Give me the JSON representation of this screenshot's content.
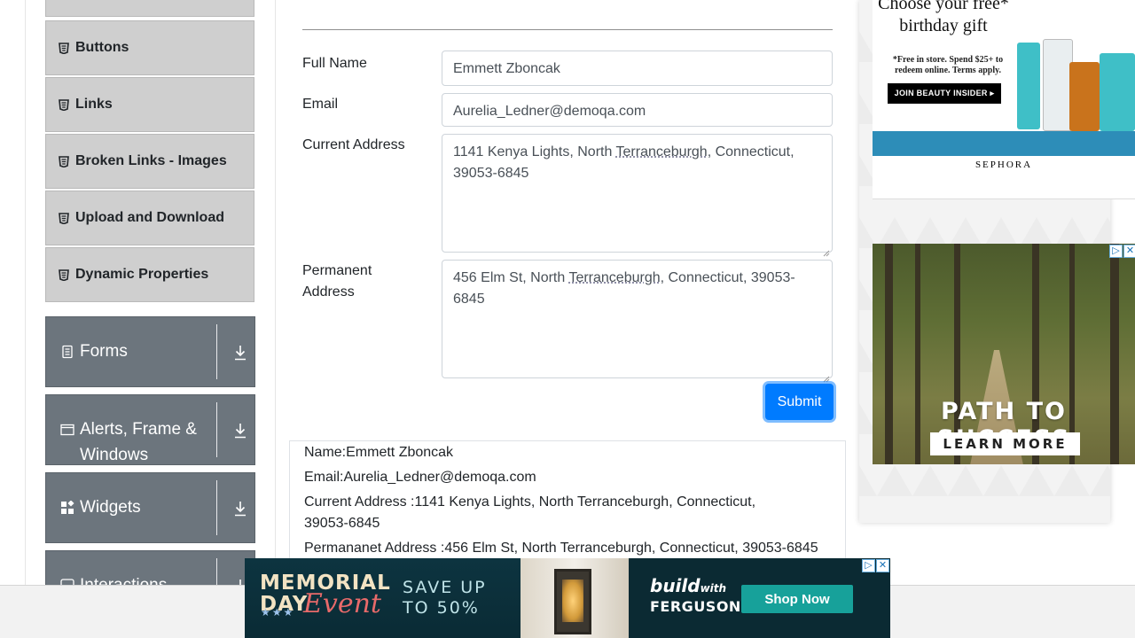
{
  "sidebar": {
    "elements_items": [
      {
        "label": "Buttons"
      },
      {
        "label": "Links"
      },
      {
        "label": "Broken Links - Images"
      },
      {
        "label": "Upload and Download"
      },
      {
        "label": "Dynamic Properties"
      }
    ],
    "groups": [
      {
        "label": "Forms",
        "icon": "form-icon"
      },
      {
        "label": "Alerts, Frame & Windows",
        "icon": "window-icon"
      },
      {
        "label": "Widgets",
        "icon": "widgets-icon"
      },
      {
        "label": "Interactions",
        "icon": "interactions-icon"
      }
    ]
  },
  "form": {
    "full_name_label": "Full Name",
    "full_name_value": "Emmett Zboncak",
    "email_label": "Email",
    "email_value": "Aurelia_Ledner@demoqa.com",
    "current_address_label": "Current Address",
    "current_address_pre": "1141 Kenya Lights, North ",
    "current_address_flagged": "Terranceburgh",
    "current_address_post": ", Connecticut, 39053-6845",
    "permanent_address_label": "Permanent Address",
    "permanent_address_pre": "456 Elm St, North ",
    "permanent_address_flagged": "Terranceburgh",
    "permanent_address_post": ", Connecticut, 39053-6845",
    "submit_label": "Submit"
  },
  "output": {
    "name_line": "Name:Emmett Zboncak",
    "email_line": "Email:Aurelia_Ledner@demoqa.com",
    "current_line": "Current Address :1141 Kenya Lights, North Terranceburgh, Connecticut, 39053-6845",
    "permanent_line": "Permananet Address :456 Elm St, North Terranceburgh, Connecticut, 39053-6845"
  },
  "ads": {
    "sephora": {
      "title": "Choose your free* birthday gift",
      "fine_print": "*Free in store. Spend $25+ to redeem online. Terms apply.",
      "button": "JOIN BEAUTY INSIDER ▸",
      "brand": "SEPHORA"
    },
    "forest": {
      "headline": "PATH TO SUCCESS",
      "cta": "LEARN MORE",
      "adchoices": "▷",
      "close": "✕"
    },
    "banner": {
      "line1": "MEMORIAL",
      "line2": "DAY",
      "event": "Event",
      "save_line1": "SAVE UP",
      "save_line2": "TO 50%",
      "brand1": "build",
      "brand1_suffix": "with",
      "brand2": "FERGUSON",
      "shop": "Shop Now",
      "adchoices": "▷",
      "close": "✕"
    }
  },
  "colors": {
    "primary": "#007bff",
    "group_bg": "#6c757d",
    "menu_bg": "#cfcfcf",
    "ferguson_teal": "#17a19a"
  }
}
